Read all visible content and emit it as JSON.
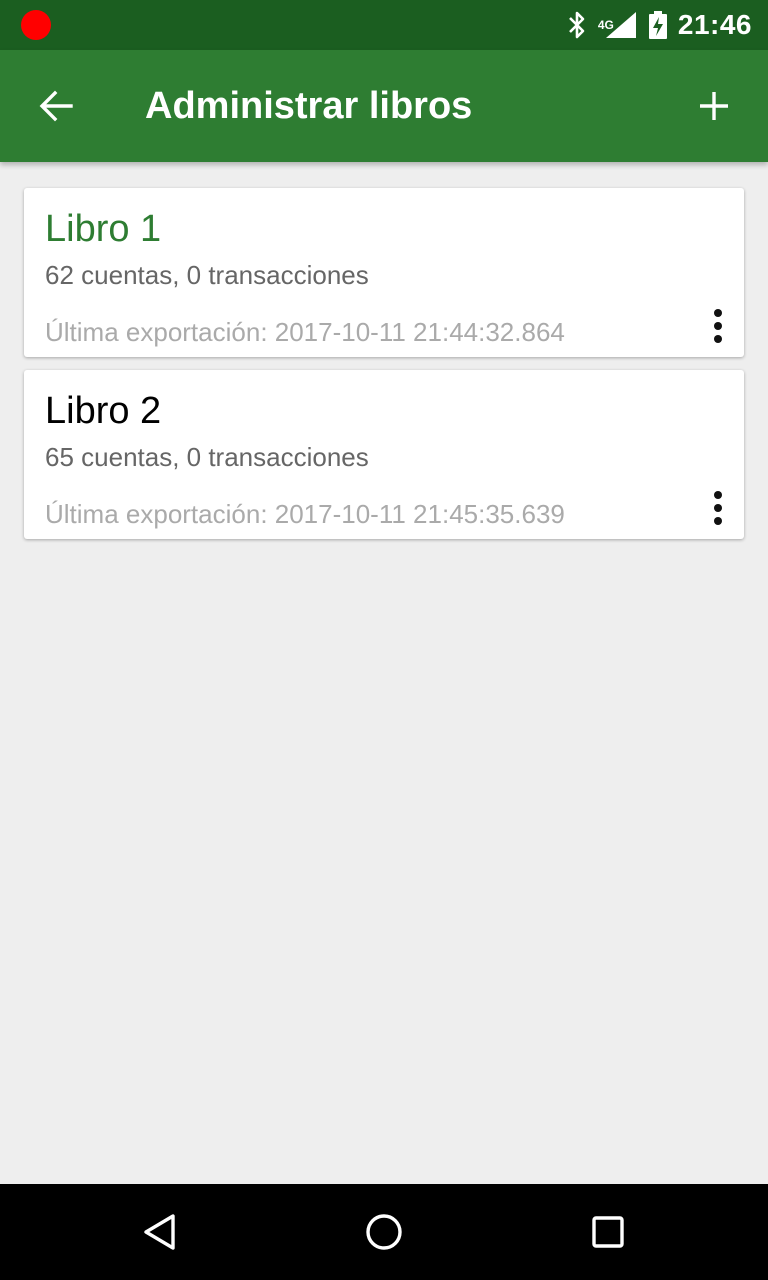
{
  "status_bar": {
    "time": "21:46",
    "network": "4G",
    "icons": [
      "record-dot-icon",
      "bluetooth-icon",
      "signal-icon",
      "battery-charging-icon"
    ]
  },
  "toolbar": {
    "title": "Administrar libros",
    "back_icon": "arrow-back-icon",
    "add_icon": "plus-icon"
  },
  "books": [
    {
      "name": "Libro 1",
      "summary": "62 cuentas, 0 transacciones",
      "last_export": "Última exportación: 2017-10-11 21:44:32.864",
      "active": true
    },
    {
      "name": "Libro 2",
      "summary": "65 cuentas, 0 transacciones",
      "last_export": "Última exportación: 2017-10-11 21:45:35.639",
      "active": false
    }
  ],
  "colors": {
    "status_bar": "#1b5e20",
    "toolbar": "#2e7d32",
    "active_book": "#2e7d32",
    "background": "#eeeeee"
  }
}
